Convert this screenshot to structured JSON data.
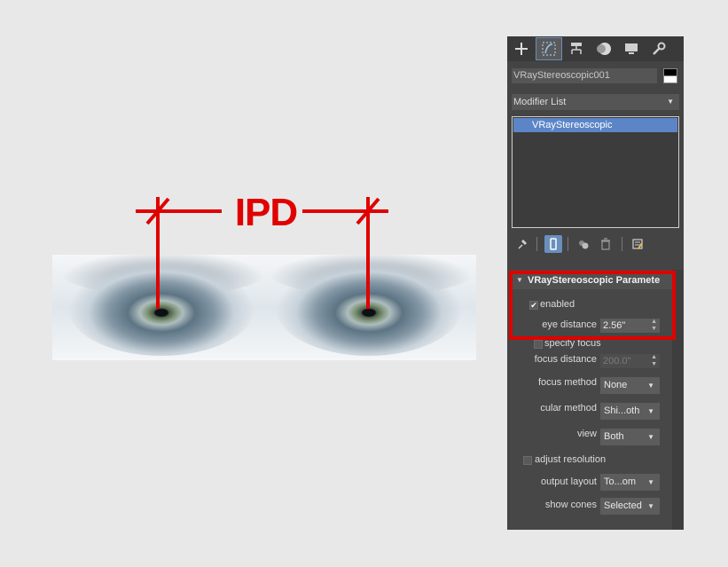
{
  "illustration": {
    "label": "IPD"
  },
  "panel": {
    "tabs": [
      "create-tab",
      "modify-tab",
      "hierarchy-tab",
      "motion-tab",
      "display-tab",
      "utilities-tab"
    ],
    "object_name": "VRayStereoscopic001",
    "modifier_list": "Modifier List",
    "stack_items": [
      "VRayStereoscopic"
    ],
    "rollout": {
      "title": "VRayStereoscopic Parameters",
      "enabled_label": "enabled",
      "enabled_checked": "✔",
      "eye_distance_label": "eye distance",
      "eye_distance_value": "2.56\"",
      "specify_focus_label": "specify focus",
      "focus_distance_label": "focus distance",
      "focus_distance_value": "200.0\"",
      "focus_method_label": "focus method",
      "focus_method_value": "None",
      "interocular_method_label": "cular method",
      "interocular_method_value": "Shi...oth",
      "view_label": "view",
      "view_value": "Both",
      "adjust_resolution_label": "adjust resolution",
      "output_layout_label": "output layout",
      "output_layout_value": "To...om",
      "show_cones_label": "show cones",
      "show_cones_value": "Selected"
    }
  },
  "colors": {
    "annotation_red": "#e00000",
    "selection_blue": "#5b85c7",
    "panel_bg": "#444444"
  }
}
